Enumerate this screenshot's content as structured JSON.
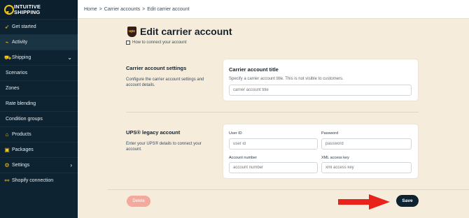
{
  "brand": {
    "line1": "INTUITIVE",
    "line2": "SHIPPING",
    "accent": "#f5c518",
    "sidebar_bg": "#0d2331"
  },
  "sidebar": {
    "items": [
      {
        "label": "Get started",
        "icon": "rocket-icon"
      },
      {
        "label": "Activity",
        "icon": "activity-icon"
      },
      {
        "label": "Shipping",
        "icon": "truck-icon"
      },
      {
        "label": "Scenarios"
      },
      {
        "label": "Zones"
      },
      {
        "label": "Rate blending"
      },
      {
        "label": "Condition groups"
      },
      {
        "label": "Products",
        "icon": "tag-icon"
      },
      {
        "label": "Packages",
        "icon": "package-icon"
      },
      {
        "label": "Settings",
        "icon": "gear-icon"
      },
      {
        "label": "Shopify connection",
        "icon": "link-icon"
      }
    ]
  },
  "breadcrumb": {
    "home": "Home",
    "carrier_accounts": "Carrier accounts",
    "current": "Edit carrier account",
    "separator": ">"
  },
  "page": {
    "title": "Edit carrier account",
    "logo_text": "ups",
    "help_link": "How to connect your account"
  },
  "carrier_settings": {
    "heading": "Carrier account settings",
    "description": "Configure the carrier account settings and account details.",
    "card_title": "Carrier account title",
    "card_desc": "Specify a carrier account title. This is not visible to customers.",
    "title_placeholder": "carrier account title"
  },
  "ups_legacy": {
    "heading": "UPS® legacy account",
    "description": "Enter your UPS® details to connect your account.",
    "user_id_label": "User ID",
    "user_id_placeholder": "user id",
    "password_label": "Password",
    "password_placeholder": "password",
    "account_number_label": "Account number",
    "account_number_placeholder": "account number",
    "xml_key_label": "XML access key",
    "xml_key_placeholder": "xml access key"
  },
  "actions": {
    "delete_label": "Delete",
    "save_label": "Save",
    "delete_color": "#f4a99d",
    "save_color": "#0d2331",
    "arrow_color": "#e8231b"
  }
}
